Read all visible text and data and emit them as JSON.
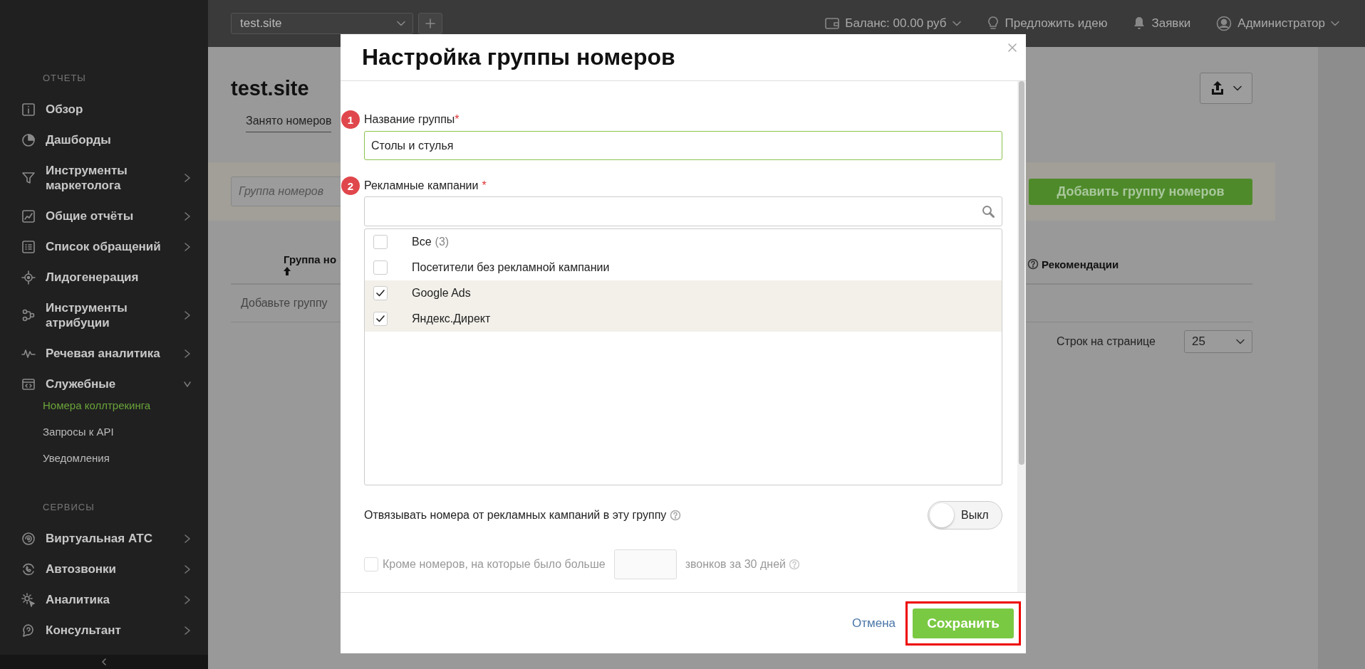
{
  "top_bar": {
    "site": "test.site",
    "balance": "Баланс: 00.00 руб",
    "suggest": "Предложить идею",
    "requests": "Заявки",
    "user": "Администратор"
  },
  "sidebar": {
    "sections": [
      {
        "title": "ОТЧЕТЫ",
        "items": [
          {
            "label": "Обзор",
            "expandable": false
          },
          {
            "label": "Дашборды",
            "expandable": false
          },
          {
            "label": "Инструменты маркетолога",
            "expandable": true,
            "expanded": false
          },
          {
            "label": "Общие отчёты",
            "expandable": true,
            "expanded": false
          },
          {
            "label": "Список обращений",
            "expandable": true,
            "expanded": false
          },
          {
            "label": "Лидогенерация",
            "expandable": false
          },
          {
            "label": "Инструменты атрибуции",
            "expandable": true,
            "expanded": false
          },
          {
            "label": "Речевая аналитика",
            "expandable": true,
            "expanded": false
          },
          {
            "label": "Служебные",
            "expandable": true,
            "expanded": true,
            "children": [
              {
                "label": "Номера коллтрекинга",
                "selected": true
              },
              {
                "label": "Запросы к API",
                "selected": false
              },
              {
                "label": "Уведомления",
                "selected": false
              }
            ]
          }
        ]
      },
      {
        "title": "СЕРВИСЫ",
        "items": [
          {
            "label": "Виртуальная АТС",
            "expandable": true,
            "expanded": false
          },
          {
            "label": "Автозвонки",
            "expandable": true,
            "expanded": false
          },
          {
            "label": "Аналитика",
            "expandable": true,
            "expanded": false
          },
          {
            "label": "Консультант",
            "expandable": true,
            "expanded": false
          }
        ]
      }
    ]
  },
  "page": {
    "title": "test.site",
    "tabs": [
      {
        "label": "Занято номеров",
        "selected": true
      }
    ],
    "filter": {
      "placeholder": "Группа номеров"
    },
    "add_button": "Добавить группу номеров",
    "table": {
      "columns": [
        {
          "label": "Группа но",
          "sorted": true,
          "help": false
        },
        {
          "label": "Рекомендации",
          "sorted": false,
          "help": true
        }
      ],
      "empty_text": "Добавьте группу"
    },
    "pagination": {
      "label": "Строк на странице",
      "value": "25"
    }
  },
  "modal": {
    "title": "Настройка группы номеров",
    "group_name": {
      "step": "1",
      "label": "Название группы",
      "mark": "*",
      "mark_gap": false,
      "value": "Столы и стулья",
      "focused": true
    },
    "campaigns": {
      "step": "2",
      "label": "Рекламные кампании",
      "mark": "*",
      "mark_gap": true,
      "items": [
        {
          "label": "Все",
          "count": "(3)",
          "checked": false
        },
        {
          "label": "Посетители без рекламной кампании",
          "checked": false
        },
        {
          "label": "Google Ads",
          "checked": true
        },
        {
          "label": "Яндекс.Директ",
          "checked": true
        }
      ]
    },
    "unbind": {
      "label": "Отвязывать номера от рекламных кампаний в эту группу",
      "on": false,
      "state_text": "Выкл"
    },
    "exclude": {
      "label": "Кроме номеров, на которые было больше",
      "suffix": "звонков за 30 дней",
      "checked": false,
      "disabled": true
    },
    "buttons": {
      "cancel": "Отмена",
      "save": "Сохранить",
      "save_highlighted": true
    }
  }
}
